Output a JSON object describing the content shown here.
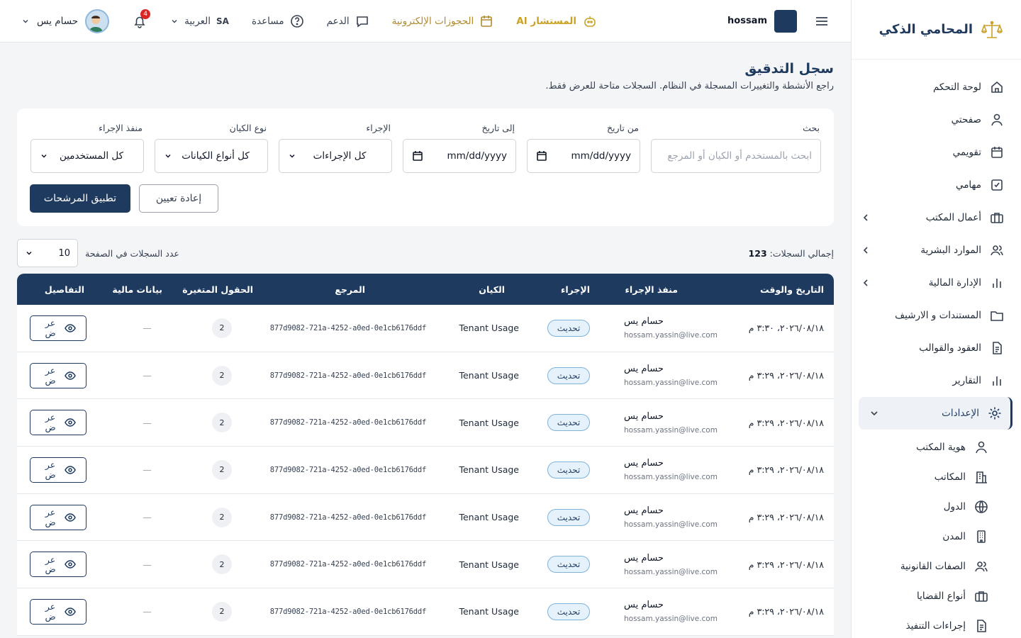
{
  "brand": {
    "name": "المحامي الذكي"
  },
  "sidebar": {
    "items": [
      {
        "label": "لوحة التحكم",
        "icon": "home-icon"
      },
      {
        "label": "صفحتي",
        "icon": "user-icon"
      },
      {
        "label": "تقويمي",
        "icon": "calendar-icon"
      },
      {
        "label": "مهامي",
        "icon": "checkbox-icon"
      },
      {
        "label": "أعمال المكتب",
        "icon": "briefcase-icon"
      },
      {
        "label": "الموارد البشرية",
        "icon": "users-icon"
      },
      {
        "label": "الإدارة المالية",
        "icon": "bar-chart-icon"
      },
      {
        "label": "المستندات و الارشيف",
        "icon": "folder-icon"
      },
      {
        "label": "العقود والقوالب",
        "icon": "document-icon"
      },
      {
        "label": "التقارير",
        "icon": "bar-chart-icon"
      },
      {
        "label": "الإعدادات",
        "icon": "gear-icon"
      }
    ],
    "sub_items": [
      {
        "label": "هوية المكتب",
        "icon": "user-icon"
      },
      {
        "label": "المكاتب",
        "icon": "building-icon"
      },
      {
        "label": "الدول",
        "icon": "globe-icon"
      },
      {
        "label": "المدن",
        "icon": "city-icon"
      },
      {
        "label": "الصفات القانونية",
        "icon": "users-icon"
      },
      {
        "label": "أنواع القضايا",
        "icon": "briefcase-icon"
      },
      {
        "label": "إجراءات التنفيذ",
        "icon": "document-icon"
      }
    ]
  },
  "header": {
    "tenant": "hossam",
    "ai_label": "المستشار AI",
    "bookings": "الحجوزات الإلكترونية",
    "support": "الدعم",
    "help": "مساعدة",
    "lang_code": "SA",
    "lang": "العربية",
    "notifications": "4",
    "user_name": "حسام يس"
  },
  "page": {
    "title": "سجل التدقيق",
    "subtitle": "راجع الأنشطة والتغييرات المسجلة في النظام. السجلات متاحة للعرض فقط."
  },
  "filters": {
    "search_label": "بحث",
    "search_placeholder": "ابحث بالمستخدم أو الكيان أو المرجع",
    "from_label": "من تاريخ",
    "from_value": "mm/dd/yyyy",
    "to_label": "إلى تاريخ",
    "to_value": "mm/dd/yyyy",
    "action_label": "الإجراء",
    "action_value": "كل الإجراءات",
    "entity_label": "نوع الكيان",
    "entity_value": "كل أنواع الكيانات",
    "actor_label": "منفذ الإجراء",
    "actor_value": "كل المستخدمين",
    "apply": "تطبيق المرشحات",
    "reset": "إعادة تعيين"
  },
  "meta": {
    "total_label": "إجمالي السجلات:",
    "total_value": "123",
    "per_page_label": "عدد السجلات في الصفحة",
    "per_page_value": "10"
  },
  "table": {
    "headers": [
      "التاريخ والوقت",
      "منفذ الإجراء",
      "الإجراء",
      "الكيان",
      "المرجع",
      "الحقول المتغيرة",
      "بيانات مالية",
      "التفاصيل"
    ],
    "rows": [
      {
        "datetime": "٢٠٢٦/٠٨/١٨، ٣:٣٠ م",
        "user": "حسام يس",
        "email": "hossam.yassin@live.com",
        "action": "تحديث",
        "entity": "Tenant Usage",
        "ref": "877d9082-721a-4252-a0ed-0e1cb6176ddf",
        "changed": "2",
        "financial": "—",
        "view": "عرض"
      },
      {
        "datetime": "٢٠٢٦/٠٨/١٨، ٣:٢٩ م",
        "user": "حسام يس",
        "email": "hossam.yassin@live.com",
        "action": "تحديث",
        "entity": "Tenant Usage",
        "ref": "877d9082-721a-4252-a0ed-0e1cb6176ddf",
        "changed": "2",
        "financial": "—",
        "view": "عرض"
      },
      {
        "datetime": "٢٠٢٦/٠٨/١٨، ٣:٢٩ م",
        "user": "حسام يس",
        "email": "hossam.yassin@live.com",
        "action": "تحديث",
        "entity": "Tenant Usage",
        "ref": "877d9082-721a-4252-a0ed-0e1cb6176ddf",
        "changed": "2",
        "financial": "—",
        "view": "عرض"
      },
      {
        "datetime": "٢٠٢٦/٠٨/١٨، ٣:٢٩ م",
        "user": "حسام يس",
        "email": "hossam.yassin@live.com",
        "action": "تحديث",
        "entity": "Tenant Usage",
        "ref": "877d9082-721a-4252-a0ed-0e1cb6176ddf",
        "changed": "2",
        "financial": "—",
        "view": "عرض"
      },
      {
        "datetime": "٢٠٢٦/٠٨/١٨، ٣:٢٩ م",
        "user": "حسام يس",
        "email": "hossam.yassin@live.com",
        "action": "تحديث",
        "entity": "Tenant Usage",
        "ref": "877d9082-721a-4252-a0ed-0e1cb6176ddf",
        "changed": "2",
        "financial": "—",
        "view": "عرض"
      },
      {
        "datetime": "٢٠٢٦/٠٨/١٨، ٣:٢٩ م",
        "user": "حسام يس",
        "email": "hossam.yassin@live.com",
        "action": "تحديث",
        "entity": "Tenant Usage",
        "ref": "877d9082-721a-4252-a0ed-0e1cb6176ddf",
        "changed": "2",
        "financial": "—",
        "view": "عرض"
      },
      {
        "datetime": "٢٠٢٦/٠٨/١٨، ٣:٢٩ م",
        "user": "حسام يس",
        "email": "hossam.yassin@live.com",
        "action": "تحديث",
        "entity": "Tenant Usage",
        "ref": "877d9082-721a-4252-a0ed-0e1cb6176ddf",
        "changed": "2",
        "financial": "—",
        "view": "عرض"
      }
    ]
  },
  "colors": {
    "primary": "#1e3a5f",
    "gold": "#c9a227",
    "badge": "#dc2626"
  }
}
